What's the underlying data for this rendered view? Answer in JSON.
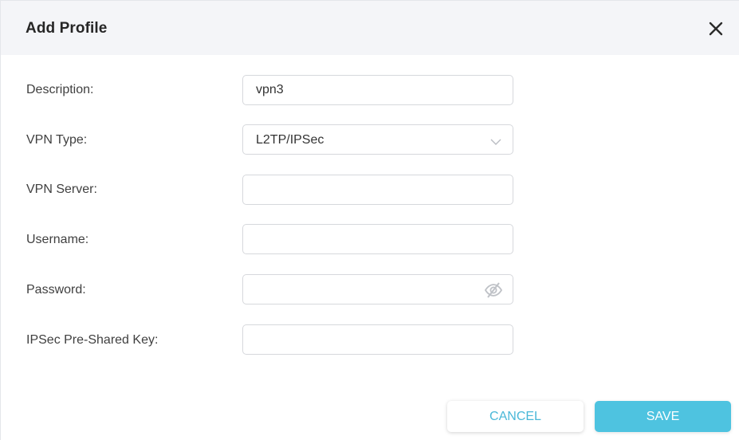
{
  "dialog": {
    "title": "Add Profile"
  },
  "form": {
    "description": {
      "label": "Description:",
      "value": "vpn3"
    },
    "vpn_type": {
      "label": "VPN Type:",
      "value": "L2TP/IPSec"
    },
    "vpn_server": {
      "label": "VPN Server:",
      "value": ""
    },
    "username": {
      "label": "Username:",
      "value": ""
    },
    "password": {
      "label": "Password:",
      "value": ""
    },
    "psk": {
      "label": "IPSec Pre-Shared Key:",
      "value": ""
    }
  },
  "buttons": {
    "cancel": "CANCEL",
    "save": "SAVE"
  },
  "icons": {
    "close": "close-icon",
    "dropdown": "chevron-down-icon",
    "password_toggle": "eye-slash-icon"
  },
  "colors": {
    "header_bg": "#f4f5f8",
    "accent": "#4ec3e0",
    "cancel_text": "#4ab8d8"
  }
}
